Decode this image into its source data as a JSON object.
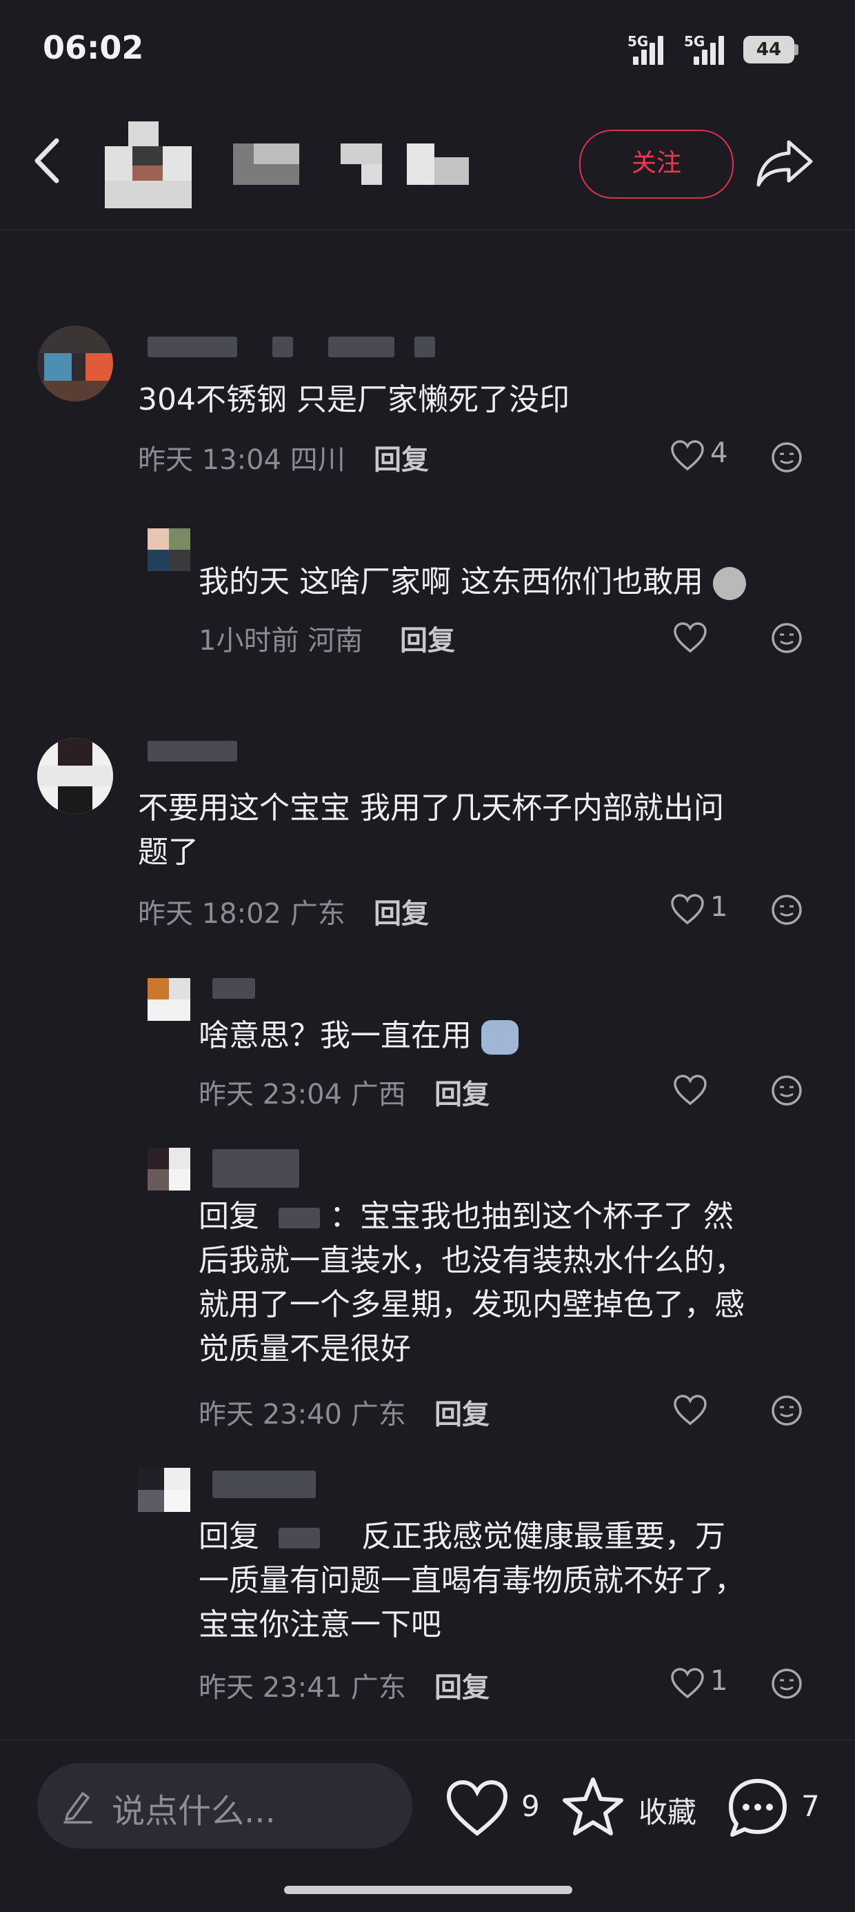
{
  "status_bar": {
    "time": "06:02",
    "net1": "5G",
    "net2": "5G",
    "battery": "44"
  },
  "header": {
    "follow_label": "关注"
  },
  "comments": [
    {
      "text": "304不锈钢 只是厂家懒死了没印",
      "time": "昨天 13:04",
      "location": "四川",
      "reply_label": "回复",
      "likes": "4"
    },
    {
      "text": "我的天 这啥厂家啊 这东西你们也敢用",
      "time": "1小时前",
      "location": "河南",
      "reply_label": "回复",
      "likes": ""
    },
    {
      "text_line1": "不要用这个宝宝 我用了几天杯子内部就出问",
      "text_line2": "题了",
      "time": "昨天 18:02",
      "location": "广东",
      "reply_label": "回复",
      "likes": "1"
    },
    {
      "text": "啥意思？我一直在用",
      "time": "昨天 23:04",
      "location": "广西",
      "reply_label": "回复",
      "likes": ""
    },
    {
      "reply_prefix": "回复",
      "line1_after": "：宝宝我也抽到这个杯子了 然",
      "line2": "后我就一直装水，也没有装热水什么的，",
      "line3": "就用了一个多星期，发现内壁掉色了，感",
      "line4": "觉质量不是很好",
      "time": "昨天 23:40",
      "location": "广东",
      "reply_label": "回复",
      "likes": ""
    },
    {
      "reply_prefix": "回复",
      "line1_after": "反正我感觉健康最重要，万",
      "line2": "一质量有问题一直喝有毒物质就不好了，",
      "line3": "宝宝你注意一下吧",
      "time": "昨天 23:41",
      "location": "广东",
      "reply_label": "回复",
      "likes": "1"
    }
  ],
  "bottom_bar": {
    "placeholder": "说点什么...",
    "like_count": "9",
    "collect_label": "收藏",
    "comment_count": "7"
  },
  "icons": [
    "back-icon",
    "share-icon",
    "heart-icon",
    "emoji-icon",
    "pencil-icon",
    "star-icon",
    "comment-bubble-icon",
    "signal-icon",
    "battery-icon"
  ],
  "colors": {
    "background": "#1b1b21",
    "accent": "#f0374d",
    "meta_text": "#8b8b93"
  }
}
